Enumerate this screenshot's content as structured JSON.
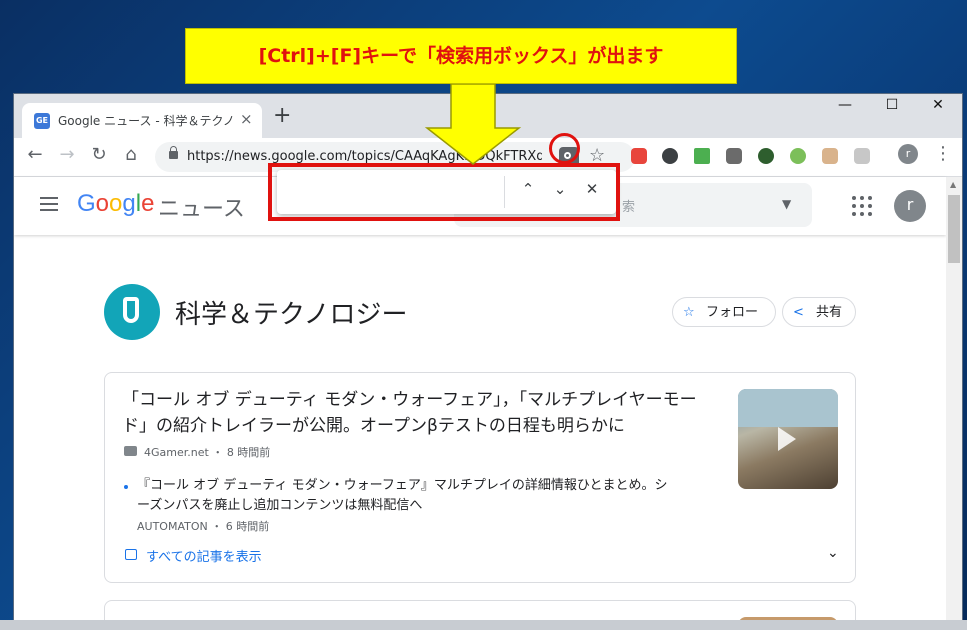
{
  "callout": {
    "text": "[Ctrl]+[F]キーで「検索用ボックス」が出ます"
  },
  "browser": {
    "tab_title": "Google ニュース - 科学＆テクノロジー",
    "tab_favicon": "GE",
    "tab_close": "×",
    "new_tab": "+",
    "window": {
      "minimize": "—",
      "maximize": "☐",
      "close": "✕"
    },
    "nav": {
      "back": "←",
      "forward": "→",
      "reload": "↻",
      "home": "⌂"
    },
    "url": "https://news.google.com/topics/CAAqKAgKIiJDQkFTRXd...",
    "star": "☆",
    "profile_initial": "r",
    "menu": "⋮"
  },
  "findbar": {
    "value": "",
    "prev": "⌃",
    "next": "⌄",
    "close": "✕"
  },
  "app": {
    "logo_letters": [
      "G",
      "o",
      "o",
      "g",
      "l",
      "e"
    ],
    "logo_colors": [
      "#4285f4",
      "#ea4335",
      "#fbbc05",
      "#4285f4",
      "#34a853",
      "#ea4335"
    ],
    "logo_sub": "ニュース",
    "search_hint": "索",
    "avatar_initial": "r"
  },
  "topic": {
    "title": "科学＆テクノロジー",
    "follow": "フォロー",
    "follow_icon": "☆",
    "share": "共有",
    "share_icon": "share-icon"
  },
  "story": {
    "headline": "「コール オブ デューティ モダン・ウォーフェア」，「マルチプレイヤーモード」の紹介トレイラーが公開。オープンβテストの日程も明らかに",
    "source": "4Gamer.net",
    "time": "8 時間前",
    "sub_headline": "『コール オブ デューティ モダン・ウォーフェア』マルチプレイの詳細情報ひとまとめ。シーズンパスを廃止し追加コンテンツは無料配信へ",
    "sub_source": "AUTOMATON",
    "sub_time": "6 時間前",
    "all_stories": "すべての記事を表示",
    "expand": "⌄"
  },
  "colors": {
    "highlight_red": "#e0120f",
    "callout_yellow": "#ffff00",
    "accent_blue": "#1a73e8",
    "topic_teal": "#12a5b8"
  }
}
